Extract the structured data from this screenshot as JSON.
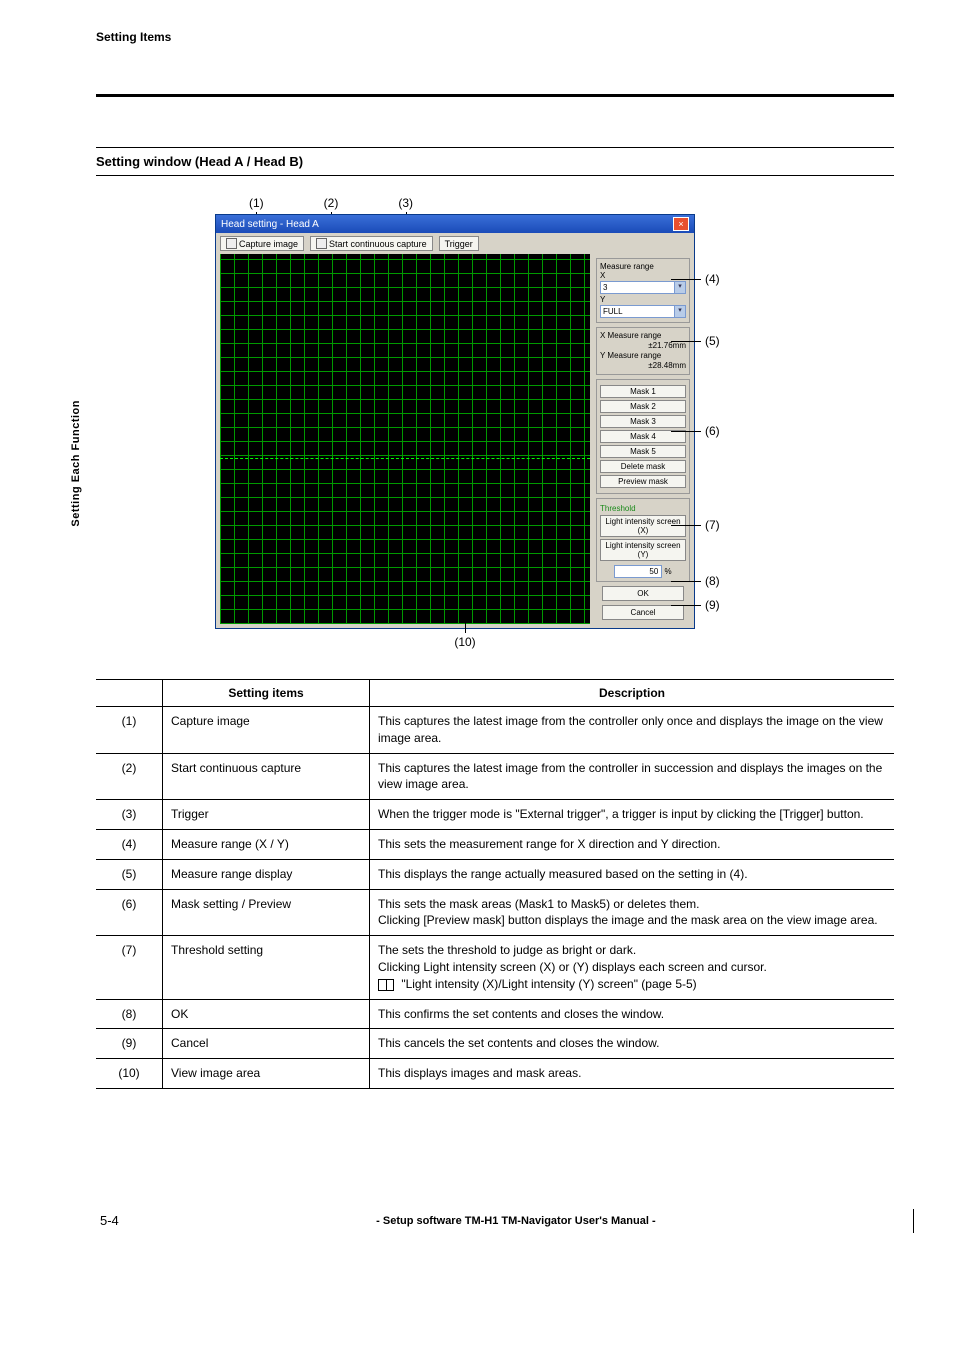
{
  "header": {
    "section": "Setting Items"
  },
  "sideTab": "Setting Each Function",
  "sectionTitle": "Setting window (Head A / Head B)",
  "callouts": {
    "top": [
      "(1)",
      "(2)",
      "(3)"
    ],
    "right": [
      "(4)",
      "(5)",
      "(6)",
      "(7)",
      "(8)",
      "(9)"
    ],
    "bottom": "(10)"
  },
  "win": {
    "title": "Head setting - Head A",
    "toolbar": {
      "capture": "Capture image",
      "continuous": "Start continuous capture",
      "trigger": "Trigger"
    },
    "rpanel": {
      "measureRange": "Measure range",
      "xLabel": "X",
      "xValue": "3",
      "yLabel": "Y",
      "yValue": "FULL",
      "xMeasureRange": "X Measure range",
      "xMeasureVal": "±21.76mm",
      "yMeasureRange": "Y Measure range",
      "yMeasureVal": "±28.48mm",
      "masks": [
        "Mask 1",
        "Mask 2",
        "Mask 3",
        "Mask 4",
        "Mask 5"
      ],
      "deleteMask": "Delete mask",
      "previewMask": "Preview mask",
      "threshold": "Threshold",
      "lisX": "Light intensity screen (X)",
      "lisY": "Light intensity screen (Y)",
      "pct": "50",
      "pctUnit": "%",
      "ok": "OK",
      "cancel": "Cancel"
    }
  },
  "table": {
    "headers": {
      "num": "",
      "setting": "Setting items",
      "desc": "Description"
    },
    "rows": [
      {
        "n": "(1)",
        "s": "Capture image",
        "d": "This captures the latest image from the controller only once and displays the image on the view image area."
      },
      {
        "n": "(2)",
        "s": "Start continuous capture",
        "d": "This captures the latest image from the controller in succession and displays the images on the view image area."
      },
      {
        "n": "(3)",
        "s": "Trigger",
        "d": "When the trigger mode is \"External trigger\", a trigger is input by clicking the [Trigger] button."
      },
      {
        "n": "(4)",
        "s": "Measure range (X / Y)",
        "d": "This sets the measurement range for X direction and Y direction."
      },
      {
        "n": "(5)",
        "s": "Measure range display",
        "d": "This displays the range actually measured based on the setting in (4)."
      },
      {
        "n": "(6)",
        "s": "Mask setting / Preview",
        "d": "This sets the mask areas (Mask1 to Mask5) or deletes them.\nClicking [Preview mask] button displays the image and the mask area on the view image area."
      },
      {
        "n": "(7)",
        "s": "Threshold setting",
        "d": "The sets the threshold to judge as bright or dark.\nClicking Light intensity screen (X) or (Y) displays each screen and cursor.",
        "ref": "\"Light intensity (X)/Light intensity (Y) screen\" (page 5-5)"
      },
      {
        "n": "(8)",
        "s": "OK",
        "d": "This confirms the set contents and closes the window."
      },
      {
        "n": "(9)",
        "s": "Cancel",
        "d": "This cancels the set contents and closes the window."
      },
      {
        "n": "(10)",
        "s": "View image area",
        "d": "This displays images and mask areas."
      }
    ]
  },
  "footer": {
    "pageNum": "5-4",
    "title": "- Setup software TM-H1 TM-Navigator User's Manual -"
  }
}
